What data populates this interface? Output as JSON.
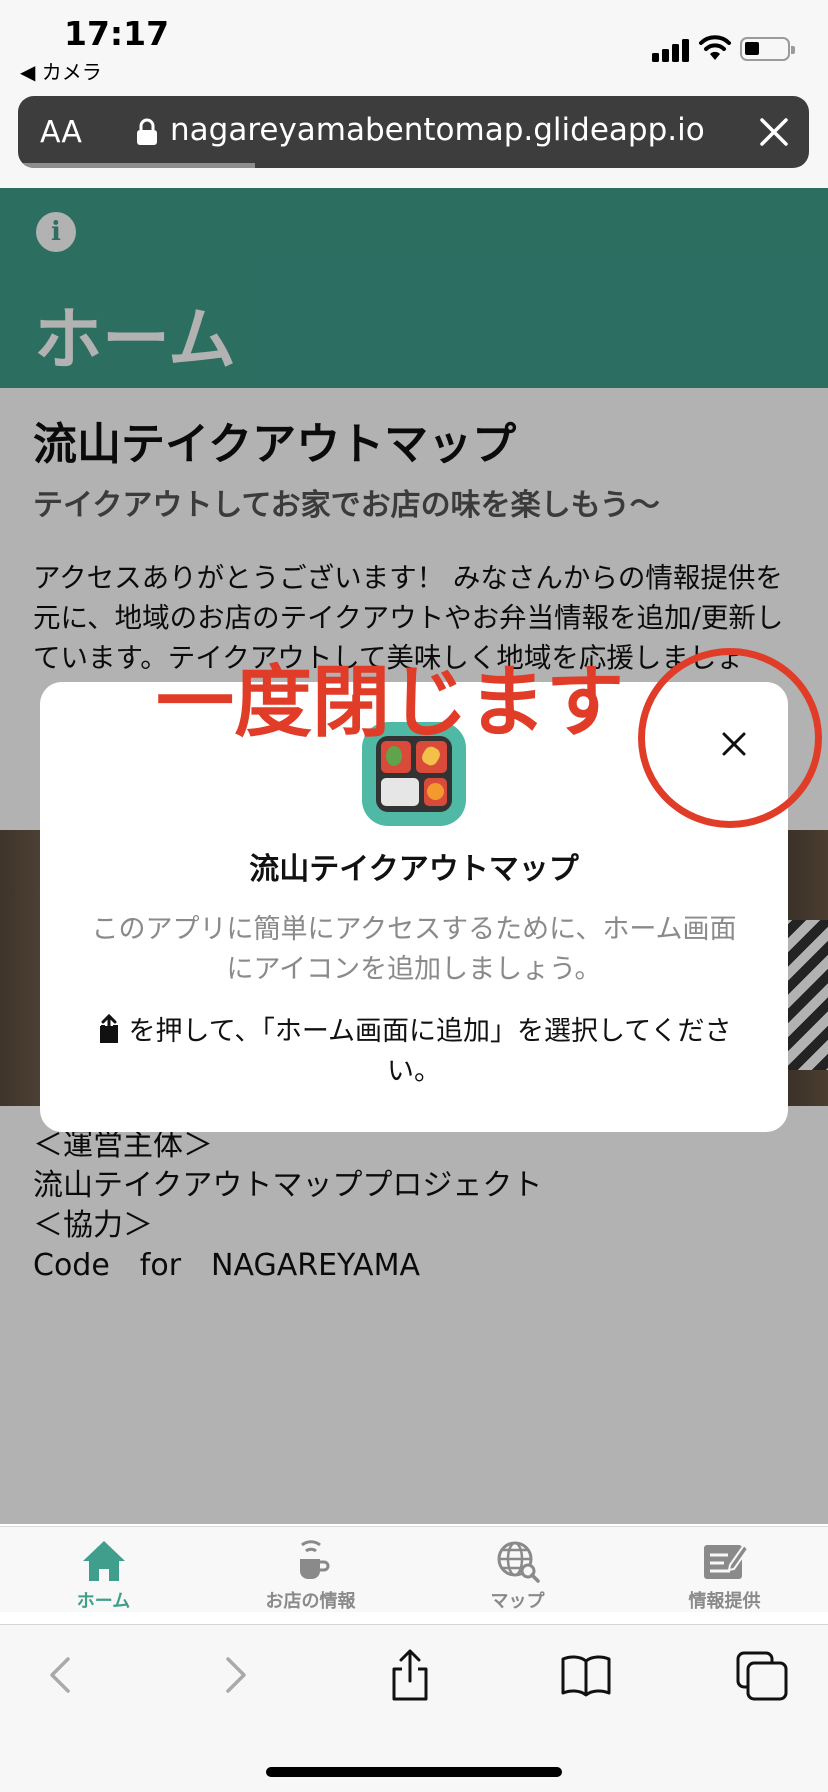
{
  "status_bar": {
    "time": "17:17",
    "back_app": "◀ カメラ"
  },
  "browser": {
    "text_size_label": "AA",
    "url": "nagareyamabentomap.glideapp.io",
    "load_progress_pct": 30
  },
  "app": {
    "header_title": "ホーム",
    "main_title": "流山テイクアウトマップ",
    "subtitle": "テイクアウトしてお家でお店の味を楽しもう〜",
    "intro": "アクセスありがとうございます！ みなさんからの情報提供を元に、地域のお店のテイクアウトやお弁当情報を追加/更新しています。テイクアウトして美味しく地域を応援しましょ",
    "operator_lines": [
      "＜運営主体＞",
      "流山テイクアウトマッププロジェクト",
      "＜協力＞",
      "Code　for　NAGAREYAMA"
    ],
    "tabs": [
      {
        "label": "ホーム",
        "icon": "house-icon",
        "active": true
      },
      {
        "label": "お店の情報",
        "icon": "takeout-cup-icon",
        "active": false
      },
      {
        "label": "マップ",
        "icon": "globe-search-icon",
        "active": false
      },
      {
        "label": "情報提供",
        "icon": "edit-form-icon",
        "active": false
      }
    ],
    "accent_color": "#3f9f8c"
  },
  "dialog": {
    "title": "流山テイクアウトマップ",
    "description": "このアプリに簡単にアクセスするために、ホーム画面にアイコンを追加しましょう。",
    "instruction": "を押して、「ホーム画面に追加」を選択してください。"
  },
  "annotation": {
    "text": "一度閉じます",
    "color": "#e03c28"
  }
}
